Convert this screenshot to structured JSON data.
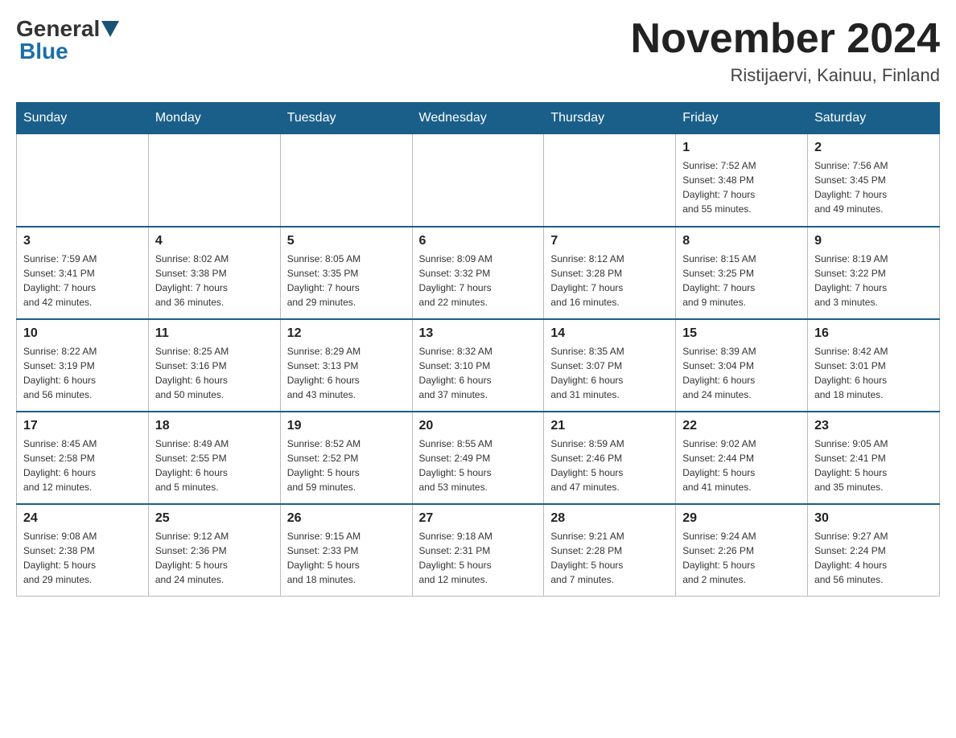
{
  "header": {
    "logo_general": "General",
    "logo_blue": "Blue",
    "title": "November 2024",
    "location": "Ristijaervi, Kainuu, Finland"
  },
  "days_of_week": [
    "Sunday",
    "Monday",
    "Tuesday",
    "Wednesday",
    "Thursday",
    "Friday",
    "Saturday"
  ],
  "weeks": [
    [
      {
        "day": "",
        "info": ""
      },
      {
        "day": "",
        "info": ""
      },
      {
        "day": "",
        "info": ""
      },
      {
        "day": "",
        "info": ""
      },
      {
        "day": "",
        "info": ""
      },
      {
        "day": "1",
        "info": "Sunrise: 7:52 AM\nSunset: 3:48 PM\nDaylight: 7 hours\nand 55 minutes."
      },
      {
        "day": "2",
        "info": "Sunrise: 7:56 AM\nSunset: 3:45 PM\nDaylight: 7 hours\nand 49 minutes."
      }
    ],
    [
      {
        "day": "3",
        "info": "Sunrise: 7:59 AM\nSunset: 3:41 PM\nDaylight: 7 hours\nand 42 minutes."
      },
      {
        "day": "4",
        "info": "Sunrise: 8:02 AM\nSunset: 3:38 PM\nDaylight: 7 hours\nand 36 minutes."
      },
      {
        "day": "5",
        "info": "Sunrise: 8:05 AM\nSunset: 3:35 PM\nDaylight: 7 hours\nand 29 minutes."
      },
      {
        "day": "6",
        "info": "Sunrise: 8:09 AM\nSunset: 3:32 PM\nDaylight: 7 hours\nand 22 minutes."
      },
      {
        "day": "7",
        "info": "Sunrise: 8:12 AM\nSunset: 3:28 PM\nDaylight: 7 hours\nand 16 minutes."
      },
      {
        "day": "8",
        "info": "Sunrise: 8:15 AM\nSunset: 3:25 PM\nDaylight: 7 hours\nand 9 minutes."
      },
      {
        "day": "9",
        "info": "Sunrise: 8:19 AM\nSunset: 3:22 PM\nDaylight: 7 hours\nand 3 minutes."
      }
    ],
    [
      {
        "day": "10",
        "info": "Sunrise: 8:22 AM\nSunset: 3:19 PM\nDaylight: 6 hours\nand 56 minutes."
      },
      {
        "day": "11",
        "info": "Sunrise: 8:25 AM\nSunset: 3:16 PM\nDaylight: 6 hours\nand 50 minutes."
      },
      {
        "day": "12",
        "info": "Sunrise: 8:29 AM\nSunset: 3:13 PM\nDaylight: 6 hours\nand 43 minutes."
      },
      {
        "day": "13",
        "info": "Sunrise: 8:32 AM\nSunset: 3:10 PM\nDaylight: 6 hours\nand 37 minutes."
      },
      {
        "day": "14",
        "info": "Sunrise: 8:35 AM\nSunset: 3:07 PM\nDaylight: 6 hours\nand 31 minutes."
      },
      {
        "day": "15",
        "info": "Sunrise: 8:39 AM\nSunset: 3:04 PM\nDaylight: 6 hours\nand 24 minutes."
      },
      {
        "day": "16",
        "info": "Sunrise: 8:42 AM\nSunset: 3:01 PM\nDaylight: 6 hours\nand 18 minutes."
      }
    ],
    [
      {
        "day": "17",
        "info": "Sunrise: 8:45 AM\nSunset: 2:58 PM\nDaylight: 6 hours\nand 12 minutes."
      },
      {
        "day": "18",
        "info": "Sunrise: 8:49 AM\nSunset: 2:55 PM\nDaylight: 6 hours\nand 5 minutes."
      },
      {
        "day": "19",
        "info": "Sunrise: 8:52 AM\nSunset: 2:52 PM\nDaylight: 5 hours\nand 59 minutes."
      },
      {
        "day": "20",
        "info": "Sunrise: 8:55 AM\nSunset: 2:49 PM\nDaylight: 5 hours\nand 53 minutes."
      },
      {
        "day": "21",
        "info": "Sunrise: 8:59 AM\nSunset: 2:46 PM\nDaylight: 5 hours\nand 47 minutes."
      },
      {
        "day": "22",
        "info": "Sunrise: 9:02 AM\nSunset: 2:44 PM\nDaylight: 5 hours\nand 41 minutes."
      },
      {
        "day": "23",
        "info": "Sunrise: 9:05 AM\nSunset: 2:41 PM\nDaylight: 5 hours\nand 35 minutes."
      }
    ],
    [
      {
        "day": "24",
        "info": "Sunrise: 9:08 AM\nSunset: 2:38 PM\nDaylight: 5 hours\nand 29 minutes."
      },
      {
        "day": "25",
        "info": "Sunrise: 9:12 AM\nSunset: 2:36 PM\nDaylight: 5 hours\nand 24 minutes."
      },
      {
        "day": "26",
        "info": "Sunrise: 9:15 AM\nSunset: 2:33 PM\nDaylight: 5 hours\nand 18 minutes."
      },
      {
        "day": "27",
        "info": "Sunrise: 9:18 AM\nSunset: 2:31 PM\nDaylight: 5 hours\nand 12 minutes."
      },
      {
        "day": "28",
        "info": "Sunrise: 9:21 AM\nSunset: 2:28 PM\nDaylight: 5 hours\nand 7 minutes."
      },
      {
        "day": "29",
        "info": "Sunrise: 9:24 AM\nSunset: 2:26 PM\nDaylight: 5 hours\nand 2 minutes."
      },
      {
        "day": "30",
        "info": "Sunrise: 9:27 AM\nSunset: 2:24 PM\nDaylight: 4 hours\nand 56 minutes."
      }
    ]
  ]
}
